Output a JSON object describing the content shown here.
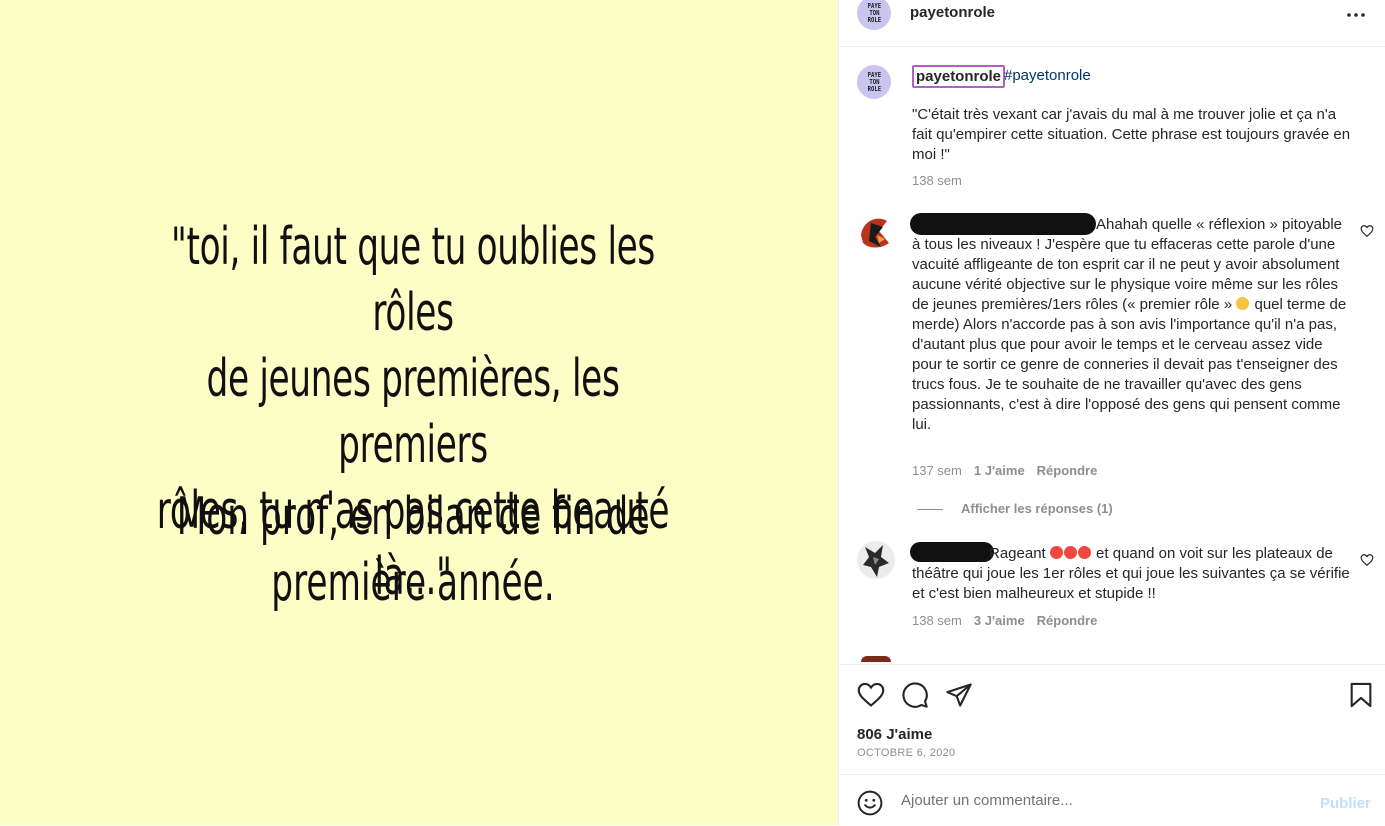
{
  "post_image": {
    "quote": "\"toi, il faut que tu oublies les rôles\nde jeunes premières, les premiers\nrôles, tu n'as pas cette beauté là...\"",
    "attribution": "Mon prof, en bilan de fin de\npremière année."
  },
  "header": {
    "avatar_text": "PAYE\nTON\nROLE",
    "username": "payetonrole",
    "more_icon": "more-horizontal-icon",
    "more_label": "•••"
  },
  "caption": {
    "username": "payetonrole",
    "hashtag": "#payetonrole",
    "text": "\"C'était très vexant car j'avais du mal à me trouver jolie et ça n'a fait qu'empirer cette situation. Cette phrase est toujours gravée en moi !\"",
    "time": "138 sem"
  },
  "comments": [
    {
      "text_first_line": "Ahahah quelle « réflexion »",
      "text_rest": "pitoyable à tous les niveaux ! J'espère que tu effaceras cette parole d'une vacuité affligeante de ton esprit car il ne peut y avoir absolument aucune vérité objective sur le physique voire même sur les rôles de jeunes premières/1ers rôles (« premier rôle » ",
      "text_after_emoji": " quel terme de merde) Alors n'accorde pas à son avis l'importance qu'il n'a pas, d'autant plus que pour avoir le temps et le cerveau assez vide pour te sortir ce genre de conneries il devait pas t'enseigner des trucs fous. Je te souhaite de ne travailler qu'avec des gens passionnants, c'est à dire l'opposé des gens qui pensent comme lui.",
      "time": "137 sem",
      "likes": "1 J'aime",
      "reply": "Répondre",
      "view_replies": "Afficher les réponses (1)"
    },
    {
      "text_first_word": "Rageant ",
      "text_rest": " et quand on voit sur les plateaux de théâtre qui joue les 1er rôles et qui joue les suivantes ça se vérifie et c'est bien malheureux et stupide !!",
      "time": "138 sem",
      "likes": "3 J'aime",
      "reply": "Répondre"
    }
  ],
  "actions": {
    "likes": "806 J'aime",
    "date": "OCTOBRE 6, 2020"
  },
  "add_comment": {
    "placeholder": "Ajouter un commentaire...",
    "publish": "Publier"
  },
  "colors": {
    "image_background": "#fdfdc6",
    "avatar_background": "#c9c5ee",
    "hashtag": "#00376b",
    "publish_disabled": "#c0dffd"
  }
}
